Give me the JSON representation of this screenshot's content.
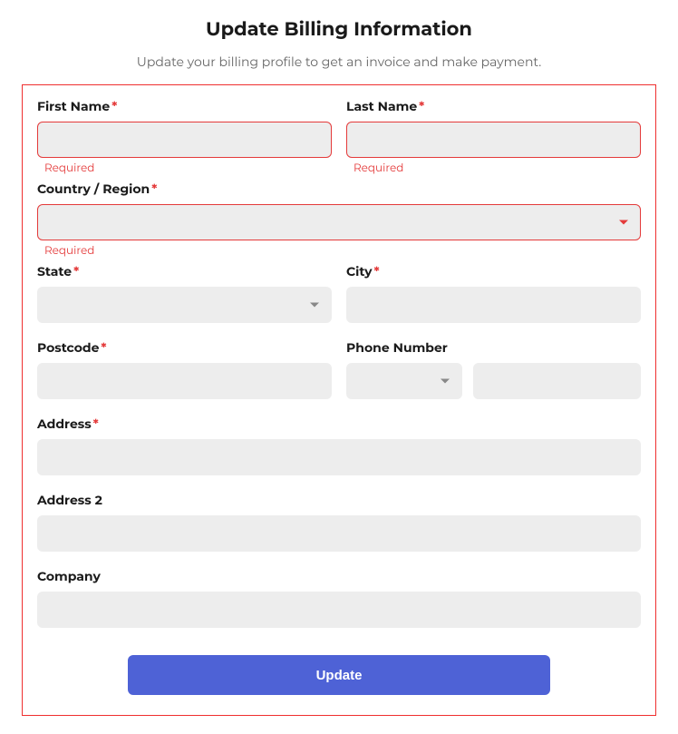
{
  "header": {
    "title": "Update Billing Information",
    "subtitle": "Update your billing profile to get an invoice and make payment."
  },
  "labels": {
    "first_name": "First Name",
    "last_name": "Last Name",
    "country": "Country / Region",
    "state": "State",
    "city": "City",
    "postcode": "Postcode",
    "phone": "Phone Number",
    "address": "Address",
    "address2": "Address 2",
    "company": "Company",
    "required_star": "*"
  },
  "values": {
    "first_name": "",
    "last_name": "",
    "country": "",
    "state": "",
    "city": "",
    "postcode": "",
    "phone_prefix": "",
    "phone_number": "",
    "address": "",
    "address2": "",
    "company": ""
  },
  "errors": {
    "first_name": "Required",
    "last_name": "Required",
    "country": "Required"
  },
  "buttons": {
    "submit": "Update"
  }
}
